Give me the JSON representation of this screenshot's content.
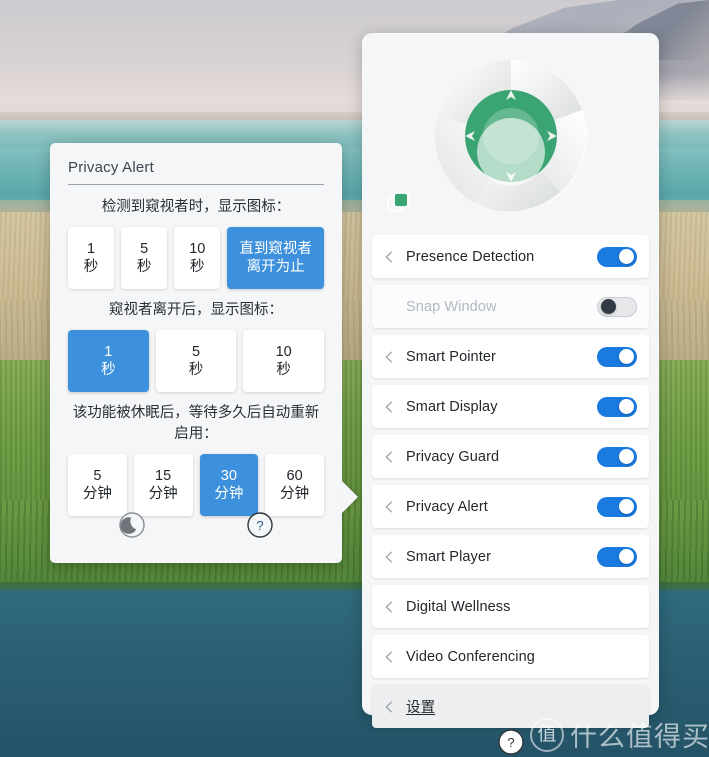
{
  "colors": {
    "accent_blue": "#3d90db",
    "toggle_on": "#1a7ae0",
    "hero_green": "#3aa472",
    "panel_bg": "#f4f6f8",
    "card_white": "#ffffff"
  },
  "right_panel": {
    "hero": {
      "logo_icon": "aperture-shutter-icon",
      "window_icon": "overlapping-windows-icon"
    },
    "features": [
      {
        "label": "Presence Detection",
        "chevron": "chevron-left-icon",
        "toggle": "on",
        "disabled": false,
        "has_toggle": true,
        "underline": false,
        "hover": false
      },
      {
        "label": "Snap Window",
        "chevron": "",
        "toggle": "off",
        "disabled": true,
        "has_toggle": true,
        "underline": false,
        "hover": false
      },
      {
        "label": "Smart Pointer",
        "chevron": "chevron-left-icon",
        "toggle": "on",
        "disabled": false,
        "has_toggle": true,
        "underline": false,
        "hover": false
      },
      {
        "label": "Smart Display",
        "chevron": "chevron-left-icon",
        "toggle": "on",
        "disabled": false,
        "has_toggle": true,
        "underline": false,
        "hover": false
      },
      {
        "label": "Privacy Guard",
        "chevron": "chevron-left-icon",
        "toggle": "on",
        "disabled": false,
        "has_toggle": true,
        "underline": false,
        "hover": false
      },
      {
        "label": "Privacy Alert",
        "chevron": "chevron-left-icon",
        "toggle": "on",
        "disabled": false,
        "has_toggle": true,
        "underline": false,
        "hover": false
      },
      {
        "label": "Smart Player",
        "chevron": "chevron-left-icon",
        "toggle": "on",
        "disabled": false,
        "has_toggle": true,
        "underline": false,
        "hover": false
      },
      {
        "label": "Digital Wellness",
        "chevron": "chevron-left-icon",
        "toggle": "",
        "disabled": false,
        "has_toggle": false,
        "underline": false,
        "hover": false
      },
      {
        "label": "Video Conferencing",
        "chevron": "chevron-left-icon",
        "toggle": "",
        "disabled": false,
        "has_toggle": false,
        "underline": false,
        "hover": false
      },
      {
        "label": "设置",
        "chevron": "chevron-left-icon",
        "toggle": "",
        "disabled": false,
        "has_toggle": false,
        "underline": true,
        "hover": true
      }
    ],
    "footer": {
      "help_icon": "help-circle-icon"
    }
  },
  "flyout": {
    "title": "Privacy Alert",
    "sections": [
      {
        "question": "检测到窥视者时，显示图标：",
        "options": [
          {
            "line1": "1",
            "line2": "秒",
            "selected": false,
            "wide": false
          },
          {
            "line1": "5",
            "line2": "秒",
            "selected": false,
            "wide": false
          },
          {
            "line1": "10",
            "line2": "秒",
            "selected": false,
            "wide": false
          },
          {
            "line1": "直到窥视者",
            "line2": "离开为止",
            "selected": true,
            "wide": true
          }
        ]
      },
      {
        "question": "窥视者离开后，显示图标：",
        "options": [
          {
            "line1": "1",
            "line2": "秒",
            "selected": true,
            "wide": false
          },
          {
            "line1": "5",
            "line2": "秒",
            "selected": false,
            "wide": false
          },
          {
            "line1": "10",
            "line2": "秒",
            "selected": false,
            "wide": false
          }
        ]
      },
      {
        "question": "该功能被休眠后，等待多久后自动重新启用：",
        "options": [
          {
            "line1": "5",
            "line2": "分钟",
            "selected": false,
            "wide": false
          },
          {
            "line1": "15",
            "line2": "分钟",
            "selected": false,
            "wide": false
          },
          {
            "line1": "30",
            "line2": "分钟",
            "selected": true,
            "wide": false
          },
          {
            "line1": "60",
            "line2": "分钟",
            "selected": false,
            "wide": false
          }
        ]
      }
    ],
    "footer": {
      "sleep_icon": "moon-sleep-icon",
      "help_icon": "help-circle-icon"
    }
  },
  "watermark": {
    "logo_char": "值",
    "text": "什么值得买"
  }
}
